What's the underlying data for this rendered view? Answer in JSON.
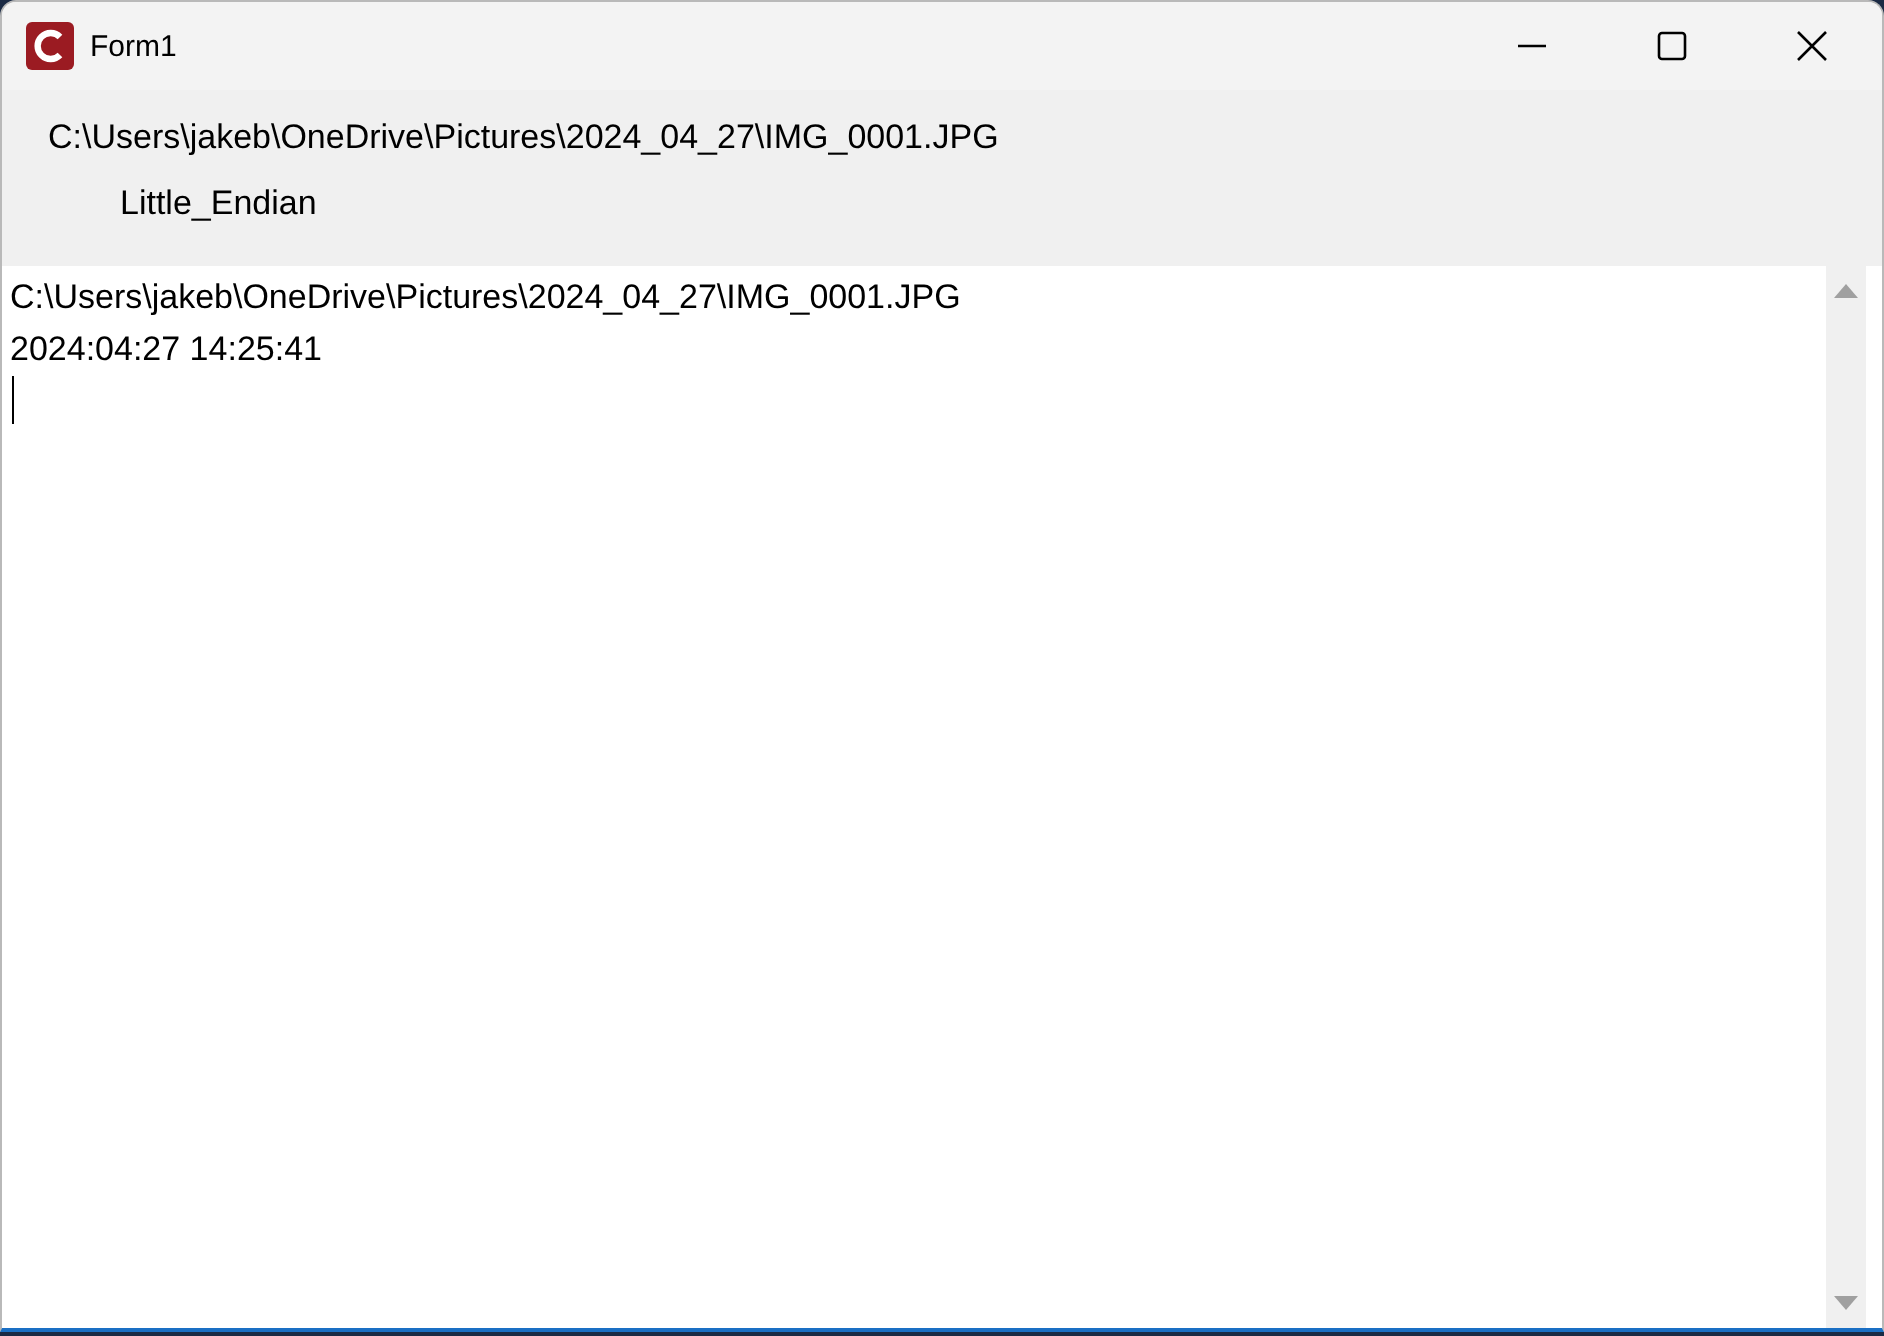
{
  "window": {
    "title": "Form1"
  },
  "labels": [
    "C:\\Users\\jakeb\\OneDrive\\Pictures\\2024_04_27\\IMG_0001.JPG",
    "Little_Endian"
  ],
  "text_box": {
    "lines": [
      "C:\\Users\\jakeb\\OneDrive\\Pictures\\2024_04_27\\IMG_0001.JPG",
      "2024:04:27 14:25:41"
    ]
  }
}
